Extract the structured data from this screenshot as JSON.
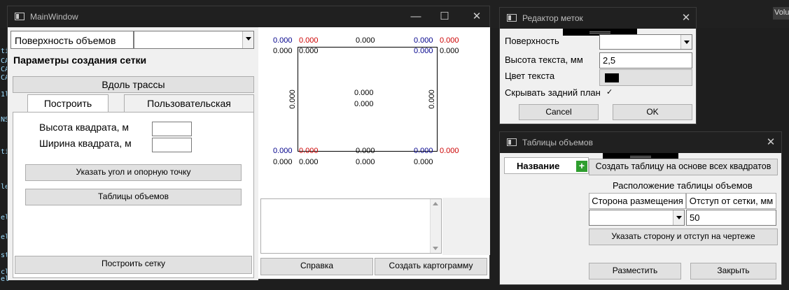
{
  "background": {
    "tab_label": "Volu",
    "code_glyphs": [
      "ti",
      "CA",
      "CA",
      "CA",
      "1l",
      "NS",
      "ti",
      "le",
      "el",
      "el",
      "st",
      "cl",
      "el"
    ]
  },
  "main": {
    "title": "MainWindow",
    "surface_label": "Поверхность объемов",
    "surface_value": "",
    "grid_params_title": "Параметры создания сетки",
    "along_route_button": "Вдоль трассы",
    "tabs": [
      "Построить",
      "Пользовательская"
    ],
    "square_height_label": "Высота квадрата, м",
    "square_width_label": "Ширина квадрата, м",
    "square_height_value": "",
    "square_width_value": "",
    "corner_button": "Указать угол и опорную точку",
    "volume_tables_button": "Таблицы объемов",
    "build_grid_button": "Построить сетку",
    "help_button": "Справка",
    "cartogram_button": "Создать картограмму",
    "preview": {
      "top_row": [
        {
          "text": "0.000",
          "color": "blue"
        },
        {
          "text": "0.000",
          "color": "red"
        },
        {
          "text": "0.000",
          "color": "black"
        },
        {
          "text": "0.000",
          "color": "blue"
        },
        {
          "text": "0.000",
          "color": "red"
        }
      ],
      "second_row": [
        {
          "text": "0.000",
          "color": "black"
        },
        {
          "text": "0.000",
          "color": "black"
        },
        {
          "text": "0.000",
          "color": "blue"
        },
        {
          "text": "0.000",
          "color": "black"
        }
      ],
      "center": [
        "0.000",
        "0.000"
      ],
      "left_vertical": "0.000",
      "right_vertical": "0.000",
      "bottom_row": [
        {
          "text": "0.000",
          "color": "blue"
        },
        {
          "text": "0.000",
          "color": "red"
        },
        {
          "text": "0.000",
          "color": "black"
        },
        {
          "text": "0.000",
          "color": "blue"
        },
        {
          "text": "0.000",
          "color": "red"
        }
      ],
      "last_row": [
        {
          "text": "0.000",
          "color": "black"
        },
        {
          "text": "0.000",
          "color": "black"
        },
        {
          "text": "0.000",
          "color": "black"
        },
        {
          "text": "0.000",
          "color": "black"
        }
      ]
    }
  },
  "labels_editor": {
    "title": "Редактор меток",
    "surface_label": "Поверхность",
    "text_height_label": "Высота текста, мм",
    "text_height_value": "2,5",
    "text_color_label": "Цвет текста",
    "text_color": "#000000",
    "hide_background_label": "Скрывать задний план",
    "hide_background_checked": true,
    "check_mark": "✓",
    "cancel_button": "Cancel",
    "ok_button": "OK"
  },
  "volume_tables": {
    "title": "Таблицы объемов",
    "name_header": "Название",
    "add_icon_glyph": "+",
    "create_table_button": "Создать таблицу на основе всех квадратов",
    "placement_title": "Расположение таблицы объемов",
    "side_header": "Сторона размещения",
    "offset_header": "Отступ от сетки, мм",
    "side_value": "",
    "offset_value": "50",
    "specify_button": "Указать сторону и отступ на чертеже",
    "place_button": "Разместить",
    "close_button": "Закрыть"
  },
  "colors": {
    "accent_green": "#2e9e2e",
    "value_blue": "#00008b",
    "value_red": "#cc0000"
  }
}
